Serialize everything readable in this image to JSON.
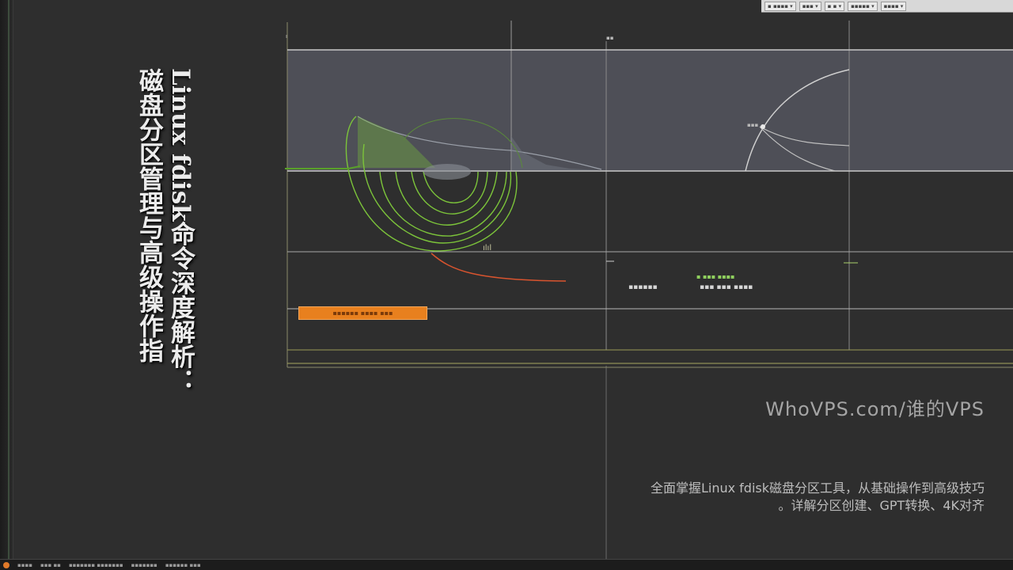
{
  "title": {
    "line1": "Linux fdisk命令深度解析：",
    "line2": "磁盘分区管理与高级操作指"
  },
  "watermark": "WhoVPS.com/谁的VPS",
  "description": {
    "line1": "全面掌握Linux fdisk磁盘分区工具，从基础操作到高级技巧",
    "line2": "。详解分区创建、GPT转换、4K对齐"
  },
  "colors": {
    "background": "#2e2e2e",
    "accent_green": "#7cc43a",
    "accent_orange": "#e8801e",
    "curve_red": "#d9542e",
    "title_text": "#ececec"
  }
}
